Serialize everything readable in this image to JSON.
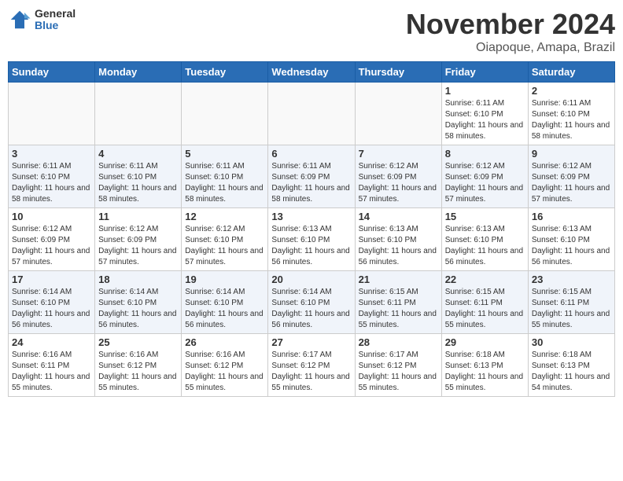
{
  "logo": {
    "general": "General",
    "blue": "Blue"
  },
  "title": {
    "month": "November 2024",
    "location": "Oiapoque, Amapa, Brazil"
  },
  "weekdays": [
    "Sunday",
    "Monday",
    "Tuesday",
    "Wednesday",
    "Thursday",
    "Friday",
    "Saturday"
  ],
  "weeks": [
    [
      {
        "day": null
      },
      {
        "day": null
      },
      {
        "day": null
      },
      {
        "day": null
      },
      {
        "day": null
      },
      {
        "day": "1",
        "sunrise": "6:11 AM",
        "sunset": "6:10 PM",
        "daylight": "11 hours and 58 minutes."
      },
      {
        "day": "2",
        "sunrise": "6:11 AM",
        "sunset": "6:10 PM",
        "daylight": "11 hours and 58 minutes."
      }
    ],
    [
      {
        "day": "3",
        "sunrise": "6:11 AM",
        "sunset": "6:10 PM",
        "daylight": "11 hours and 58 minutes."
      },
      {
        "day": "4",
        "sunrise": "6:11 AM",
        "sunset": "6:10 PM",
        "daylight": "11 hours and 58 minutes."
      },
      {
        "day": "5",
        "sunrise": "6:11 AM",
        "sunset": "6:10 PM",
        "daylight": "11 hours and 58 minutes."
      },
      {
        "day": "6",
        "sunrise": "6:11 AM",
        "sunset": "6:09 PM",
        "daylight": "11 hours and 58 minutes."
      },
      {
        "day": "7",
        "sunrise": "6:12 AM",
        "sunset": "6:09 PM",
        "daylight": "11 hours and 57 minutes."
      },
      {
        "day": "8",
        "sunrise": "6:12 AM",
        "sunset": "6:09 PM",
        "daylight": "11 hours and 57 minutes."
      },
      {
        "day": "9",
        "sunrise": "6:12 AM",
        "sunset": "6:09 PM",
        "daylight": "11 hours and 57 minutes."
      }
    ],
    [
      {
        "day": "10",
        "sunrise": "6:12 AM",
        "sunset": "6:09 PM",
        "daylight": "11 hours and 57 minutes."
      },
      {
        "day": "11",
        "sunrise": "6:12 AM",
        "sunset": "6:09 PM",
        "daylight": "11 hours and 57 minutes."
      },
      {
        "day": "12",
        "sunrise": "6:12 AM",
        "sunset": "6:10 PM",
        "daylight": "11 hours and 57 minutes."
      },
      {
        "day": "13",
        "sunrise": "6:13 AM",
        "sunset": "6:10 PM",
        "daylight": "11 hours and 56 minutes."
      },
      {
        "day": "14",
        "sunrise": "6:13 AM",
        "sunset": "6:10 PM",
        "daylight": "11 hours and 56 minutes."
      },
      {
        "day": "15",
        "sunrise": "6:13 AM",
        "sunset": "6:10 PM",
        "daylight": "11 hours and 56 minutes."
      },
      {
        "day": "16",
        "sunrise": "6:13 AM",
        "sunset": "6:10 PM",
        "daylight": "11 hours and 56 minutes."
      }
    ],
    [
      {
        "day": "17",
        "sunrise": "6:14 AM",
        "sunset": "6:10 PM",
        "daylight": "11 hours and 56 minutes."
      },
      {
        "day": "18",
        "sunrise": "6:14 AM",
        "sunset": "6:10 PM",
        "daylight": "11 hours and 56 minutes."
      },
      {
        "day": "19",
        "sunrise": "6:14 AM",
        "sunset": "6:10 PM",
        "daylight": "11 hours and 56 minutes."
      },
      {
        "day": "20",
        "sunrise": "6:14 AM",
        "sunset": "6:10 PM",
        "daylight": "11 hours and 56 minutes."
      },
      {
        "day": "21",
        "sunrise": "6:15 AM",
        "sunset": "6:11 PM",
        "daylight": "11 hours and 55 minutes."
      },
      {
        "day": "22",
        "sunrise": "6:15 AM",
        "sunset": "6:11 PM",
        "daylight": "11 hours and 55 minutes."
      },
      {
        "day": "23",
        "sunrise": "6:15 AM",
        "sunset": "6:11 PM",
        "daylight": "11 hours and 55 minutes."
      }
    ],
    [
      {
        "day": "24",
        "sunrise": "6:16 AM",
        "sunset": "6:11 PM",
        "daylight": "11 hours and 55 minutes."
      },
      {
        "day": "25",
        "sunrise": "6:16 AM",
        "sunset": "6:12 PM",
        "daylight": "11 hours and 55 minutes."
      },
      {
        "day": "26",
        "sunrise": "6:16 AM",
        "sunset": "6:12 PM",
        "daylight": "11 hours and 55 minutes."
      },
      {
        "day": "27",
        "sunrise": "6:17 AM",
        "sunset": "6:12 PM",
        "daylight": "11 hours and 55 minutes."
      },
      {
        "day": "28",
        "sunrise": "6:17 AM",
        "sunset": "6:12 PM",
        "daylight": "11 hours and 55 minutes."
      },
      {
        "day": "29",
        "sunrise": "6:18 AM",
        "sunset": "6:13 PM",
        "daylight": "11 hours and 55 minutes."
      },
      {
        "day": "30",
        "sunrise": "6:18 AM",
        "sunset": "6:13 PM",
        "daylight": "11 hours and 54 minutes."
      }
    ]
  ]
}
